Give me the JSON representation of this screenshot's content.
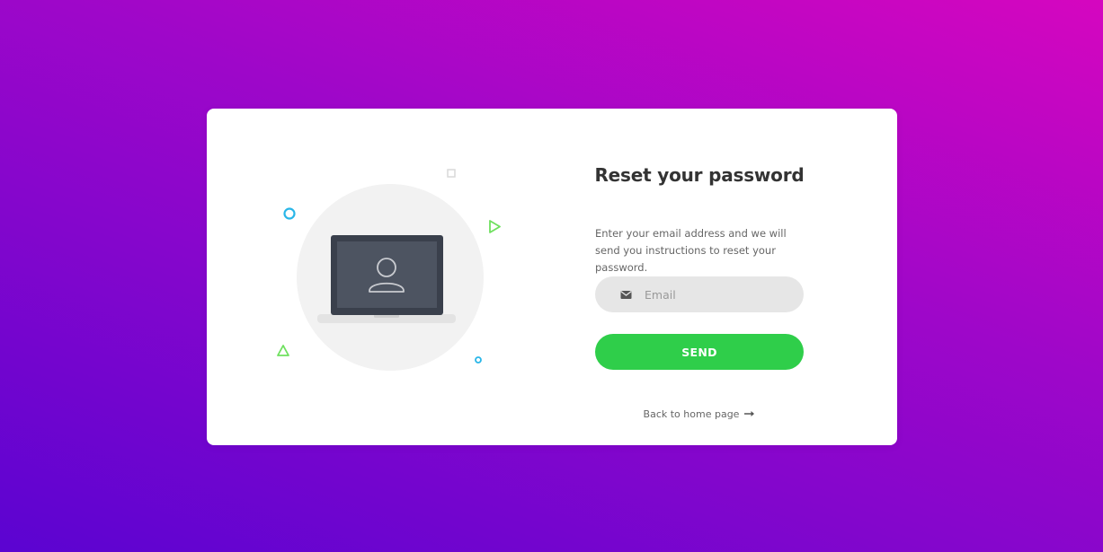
{
  "page": {
    "title": "Reset your password",
    "description": "Enter your email address and we will send you instructions to reset your password."
  },
  "form": {
    "email_placeholder": "Email",
    "email_icon": "envelope-icon",
    "send_label": "SEND"
  },
  "footer": {
    "back_label": "Back to home page",
    "back_icon": "arrow-right-icon"
  },
  "colors": {
    "gradient_start": "#d506bf",
    "gradient_end": "#5b04d1",
    "card": "#ffffff",
    "button": "#2fce4a",
    "input_bg": "#e6e6e6",
    "laptop": "#3a404c",
    "accent_blue": "#29b6e8",
    "accent_green": "#6fe05f"
  },
  "illustration": {
    "icon": "laptop-user-icon"
  }
}
